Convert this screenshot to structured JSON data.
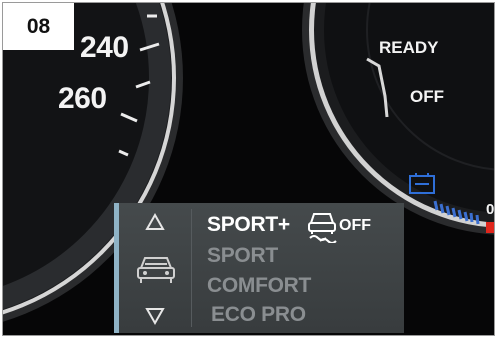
{
  "figure_number": "08",
  "speedometer": {
    "marks": [
      "240",
      "260"
    ]
  },
  "power_gauge": {
    "ready_label": "READY",
    "off_label": "OFF"
  },
  "fuel_gauge": {
    "zero_label": "0"
  },
  "drive_mode_menu": {
    "modes": [
      {
        "label": "SPORT+",
        "state": "selected"
      },
      {
        "label": "SPORT",
        "state": "available"
      },
      {
        "label": "COMFORT",
        "state": "available"
      },
      {
        "label": "ECO PRO",
        "state": "available"
      }
    ],
    "dsc_status": "OFF",
    "icons": [
      "up-arrow-icon",
      "car-front-icon",
      "down-arrow-icon",
      "dsc-traction-icon"
    ]
  },
  "colors": {
    "accent_bar": "#8fb3c6",
    "warning": "#e0261c",
    "fuel_icon": "#2f6fd8"
  }
}
